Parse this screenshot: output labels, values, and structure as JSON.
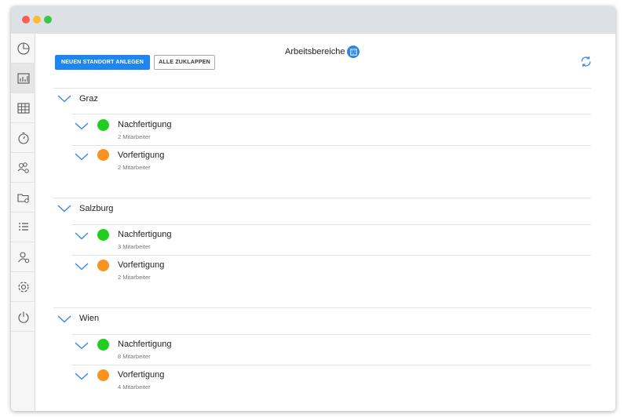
{
  "header": {
    "title": "Arbeitsbereiche",
    "title_icon": "building-icon"
  },
  "toolbar": {
    "new_location_label": "NEUEN STANDORT ANLEGEN",
    "collapse_all_label": "ALLE ZUKLAPPEN",
    "refresh_icon": "refresh-icon"
  },
  "sidebar": {
    "items": [
      {
        "icon": "pie-chart-icon"
      },
      {
        "icon": "bar-chart-icon",
        "active": true
      },
      {
        "icon": "calendar-grid-icon"
      },
      {
        "icon": "stopwatch-icon"
      },
      {
        "icon": "users-settings-icon"
      },
      {
        "icon": "folder-settings-icon"
      },
      {
        "icon": "list-icon"
      },
      {
        "icon": "user-settings-icon"
      },
      {
        "icon": "gear-icon"
      },
      {
        "icon": "power-icon"
      }
    ]
  },
  "colors": {
    "accent": "#1f86f0",
    "status_green": "#22cc22",
    "status_orange": "#f7931e"
  },
  "locations": [
    {
      "name": "Graz",
      "departments": [
        {
          "name": "Nachfertigung",
          "count": "2 Mitarbeiter",
          "status": "green"
        },
        {
          "name": "Vorfertigung",
          "count": "2 Mitarbeiter",
          "status": "orange"
        }
      ]
    },
    {
      "name": "Salzburg",
      "departments": [
        {
          "name": "Nachfertigung",
          "count": "3 Mitarbeiter",
          "status": "green"
        },
        {
          "name": "Vorfertigung",
          "count": "2 Mitarbeiter",
          "status": "orange"
        }
      ]
    },
    {
      "name": "Wien",
      "departments": [
        {
          "name": "Nachfertigung",
          "count": "8 Mitarbeiter",
          "status": "green"
        },
        {
          "name": "Vorfertigung",
          "count": "4 Mitarbeiter",
          "status": "orange"
        }
      ]
    }
  ]
}
